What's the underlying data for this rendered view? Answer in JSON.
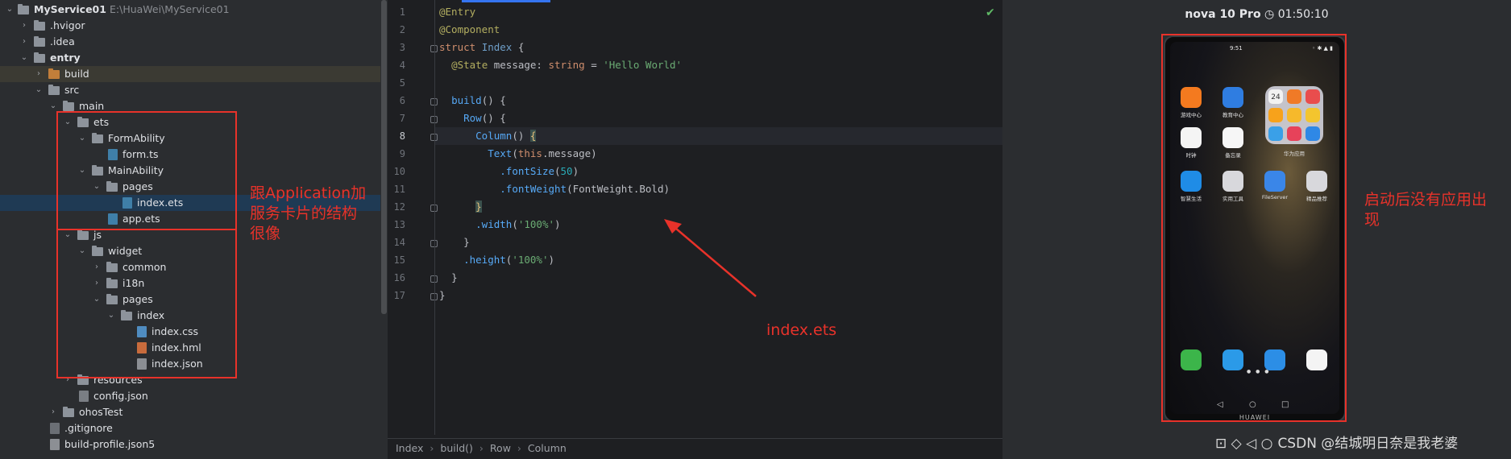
{
  "tree": {
    "root_label": "MyService01",
    "root_path": "E:\\HuaWei\\MyService01",
    "items": [
      {
        "label": "MyService01",
        "path": "E:\\HuaWei\\MyService01"
      },
      {
        "label": ".hvigor"
      },
      {
        "label": ".idea"
      },
      {
        "label": "entry"
      },
      {
        "label": "build"
      },
      {
        "label": "src"
      },
      {
        "label": "main"
      },
      {
        "label": "ets"
      },
      {
        "label": "FormAbility"
      },
      {
        "label": "form.ts"
      },
      {
        "label": "MainAbility"
      },
      {
        "label": "pages"
      },
      {
        "label": "index.ets"
      },
      {
        "label": "app.ets"
      },
      {
        "label": "js"
      },
      {
        "label": "widget"
      },
      {
        "label": "common"
      },
      {
        "label": "i18n"
      },
      {
        "label": "pages"
      },
      {
        "label": "index"
      },
      {
        "label": "index.css"
      },
      {
        "label": "index.hml"
      },
      {
        "label": "index.json"
      },
      {
        "label": "resources"
      },
      {
        "label": "config.json"
      },
      {
        "label": "ohosTest"
      },
      {
        "label": ".gitignore"
      },
      {
        "label": "build-profile.json5"
      }
    ]
  },
  "editor": {
    "line_numbers": [
      "1",
      "2",
      "3",
      "4",
      "5",
      "6",
      "7",
      "8",
      "9",
      "10",
      "11",
      "12",
      "13",
      "14",
      "15",
      "16",
      "17"
    ],
    "current_line": "8",
    "code": {
      "l1": "@Entry",
      "l2": "@Component",
      "l3a": "struct",
      "l3b": "Index",
      "l3c": "{",
      "l4a": "@State",
      "l4b": "message:",
      "l4c": "string",
      "l4d": "=",
      "l4e": "'Hello World'",
      "l6a": "build",
      "l6b": "() {",
      "l7a": "Row",
      "l7b": "() {",
      "l8a": "Column",
      "l8b": "() ",
      "l8c": "{",
      "l9a": "Text",
      "l9b": "(",
      "l9c": "this",
      "l9d": ".message)",
      "l10a": ".fontSize",
      "l10b": "(",
      "l10c": "50",
      "l10d": ")",
      "l11a": ".fontWeight",
      "l11b": "(FontWeight.Bold)",
      "l12": "}",
      "l13a": ".width",
      "l13b": "(",
      "l13c": "'100%'",
      "l13d": ")",
      "l14": "}",
      "l15a": ".height",
      "l15b": "(",
      "l15c": "'100%'",
      "l15d": ")",
      "l16": "}",
      "l17": "}"
    },
    "breadcrumb": [
      "Index",
      "build()",
      "Row",
      "Column"
    ]
  },
  "preview": {
    "device_name": "nova 10 Pro",
    "timer": "01:50:10",
    "status_time": "9:51",
    "brand": "HUAWEI",
    "apps_row1": [
      "游戏中心",
      "教育中心"
    ],
    "apps_row2": [
      "时钟",
      "备忘录",
      "华为应用"
    ],
    "apps_row3": [
      "智慧生活",
      "实用工具",
      "FileServer",
      "精品推荐"
    ],
    "folder_date": "24"
  },
  "annotations": {
    "structure_note": "跟Application加服务卡片的结构很像",
    "structure_note_l1": "跟Application加",
    "structure_note_l2": "服务卡片的结构",
    "structure_note_l3": "很像",
    "file_note": "index.ets",
    "result_note_l1": "启动后没有应用出",
    "result_note_l2": "现"
  },
  "watermark": "CSDN @结城明日奈是我老婆",
  "colors": {
    "annotation": "#e8322a",
    "accent": "#3574f0"
  }
}
